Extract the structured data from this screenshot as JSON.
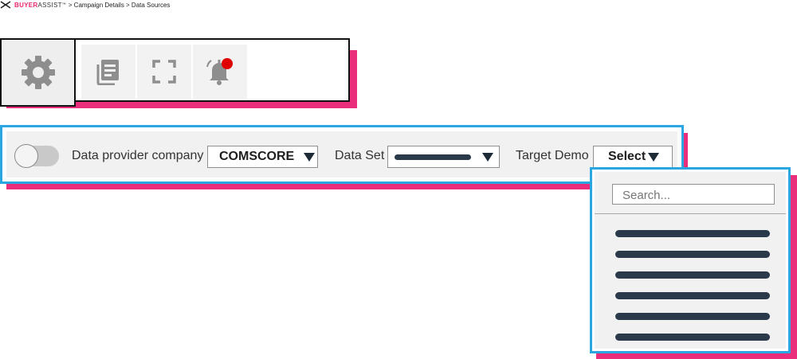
{
  "breadcrumb": {
    "brand_bold": "BUYER",
    "brand_light": "ASSIST",
    "brand_tm": "™",
    "path": "> Campaign Details > Data Sources"
  },
  "toolbar": {
    "buttons": [
      {
        "name": "settings",
        "icon": "gear-icon",
        "active": true
      },
      {
        "name": "reports",
        "icon": "document-icon"
      },
      {
        "name": "fullscreen",
        "icon": "fullscreen-icon"
      },
      {
        "name": "notifications",
        "icon": "bell-icon",
        "badge": true
      }
    ]
  },
  "filters": {
    "toggle_on": false,
    "provider_label": "Data provider company",
    "provider_value": "COMSCORE",
    "dataset_label": "Data Set",
    "target_label": "Target Demo",
    "target_value": "Select"
  },
  "dropdown": {
    "search_placeholder": "Search...",
    "item_count_visible": 6
  },
  "colors": {
    "accent_pink": "#ea2e7b",
    "highlight_blue": "#2aa7e0",
    "badge_red": "#e00000",
    "icon_gray": "#8e8e8e",
    "placeholder_navy": "#2b3a4b"
  }
}
